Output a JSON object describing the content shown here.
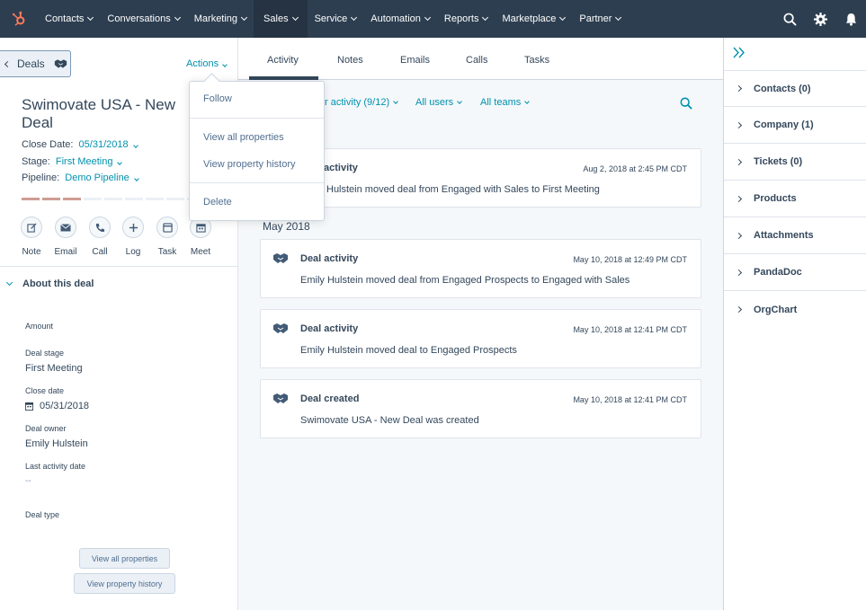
{
  "nav": {
    "items": [
      {
        "label": "Contacts"
      },
      {
        "label": "Conversations"
      },
      {
        "label": "Marketing"
      },
      {
        "label": "Sales"
      },
      {
        "label": "Service"
      },
      {
        "label": "Automation"
      },
      {
        "label": "Reports"
      },
      {
        "label": "Marketplace"
      },
      {
        "label": "Partner"
      }
    ],
    "active": "Sales",
    "colors": {
      "bar": "#2d3e50",
      "logo": "#ff7a59"
    }
  },
  "left": {
    "back_label": "Deals",
    "actions_label": "Actions",
    "deal_title": "Swimovate USA - New Deal",
    "close_date_label": "Close Date:",
    "close_date_value": "05/31/2018",
    "stage_label": "Stage:",
    "stage_value": "First Meeting",
    "pipeline_label": "Pipeline:",
    "pipeline_value": "Demo Pipeline",
    "stage_progress": {
      "completed": 3,
      "total": 9
    },
    "quick_actions": [
      {
        "label": "Note",
        "icon": "note-icon"
      },
      {
        "label": "Email",
        "icon": "email-icon"
      },
      {
        "label": "Call",
        "icon": "phone-icon"
      },
      {
        "label": "Log",
        "icon": "plus-icon"
      },
      {
        "label": "Task",
        "icon": "task-icon"
      },
      {
        "label": "Meet",
        "icon": "calendar-icon"
      }
    ],
    "about_title": "About this deal",
    "fields": {
      "amount_label": "Amount",
      "deal_stage_label": "Deal stage",
      "deal_stage_value": "First Meeting",
      "close_date_label": "Close date",
      "close_date_value": "05/31/2018",
      "deal_owner_label": "Deal owner",
      "deal_owner_value": "Emily Hulstein",
      "last_activity_label": "Last activity date",
      "last_activity_value": "--",
      "deal_type_label": "Deal type"
    },
    "view_all_properties": "View all properties",
    "view_property_history": "View property history"
  },
  "dropdown": {
    "follow": "Follow",
    "view_all_properties": "View all properties",
    "view_property_history": "View property history",
    "delete": "Delete"
  },
  "main": {
    "tabs": [
      {
        "label": "Activity"
      },
      {
        "label": "Notes"
      },
      {
        "label": "Emails"
      },
      {
        "label": "Calls"
      },
      {
        "label": "Tasks"
      }
    ],
    "active_tab": "Activity",
    "filters": {
      "activity": "r activity (9/12)",
      "users": "All users",
      "teams": "All teams"
    },
    "month_label": "May 2018",
    "cards": [
      {
        "title": "activity",
        "date": "Aug 2, 2018 at 2:45 PM CDT",
        "body": "Hulstein moved deal from Engaged with Sales to First Meeting"
      },
      {
        "title": "Deal activity",
        "date": "May 10, 2018 at 12:49 PM CDT",
        "body": "Emily Hulstein moved deal from Engaged Prospects to Engaged with Sales"
      },
      {
        "title": "Deal activity",
        "date": "May 10, 2018 at 12:41 PM CDT",
        "body": "Emily Hulstein moved deal to Engaged Prospects"
      },
      {
        "title": "Deal created",
        "date": "May 10, 2018 at 12:41 PM CDT",
        "body": "Swimovate USA - New Deal was created"
      }
    ]
  },
  "right": {
    "sections": [
      {
        "label": "Contacts (0)"
      },
      {
        "label": "Company (1)"
      },
      {
        "label": "Tickets (0)"
      },
      {
        "label": "Products"
      },
      {
        "label": "Attachments"
      },
      {
        "label": "PandaDoc"
      },
      {
        "label": "OrgChart"
      }
    ]
  }
}
